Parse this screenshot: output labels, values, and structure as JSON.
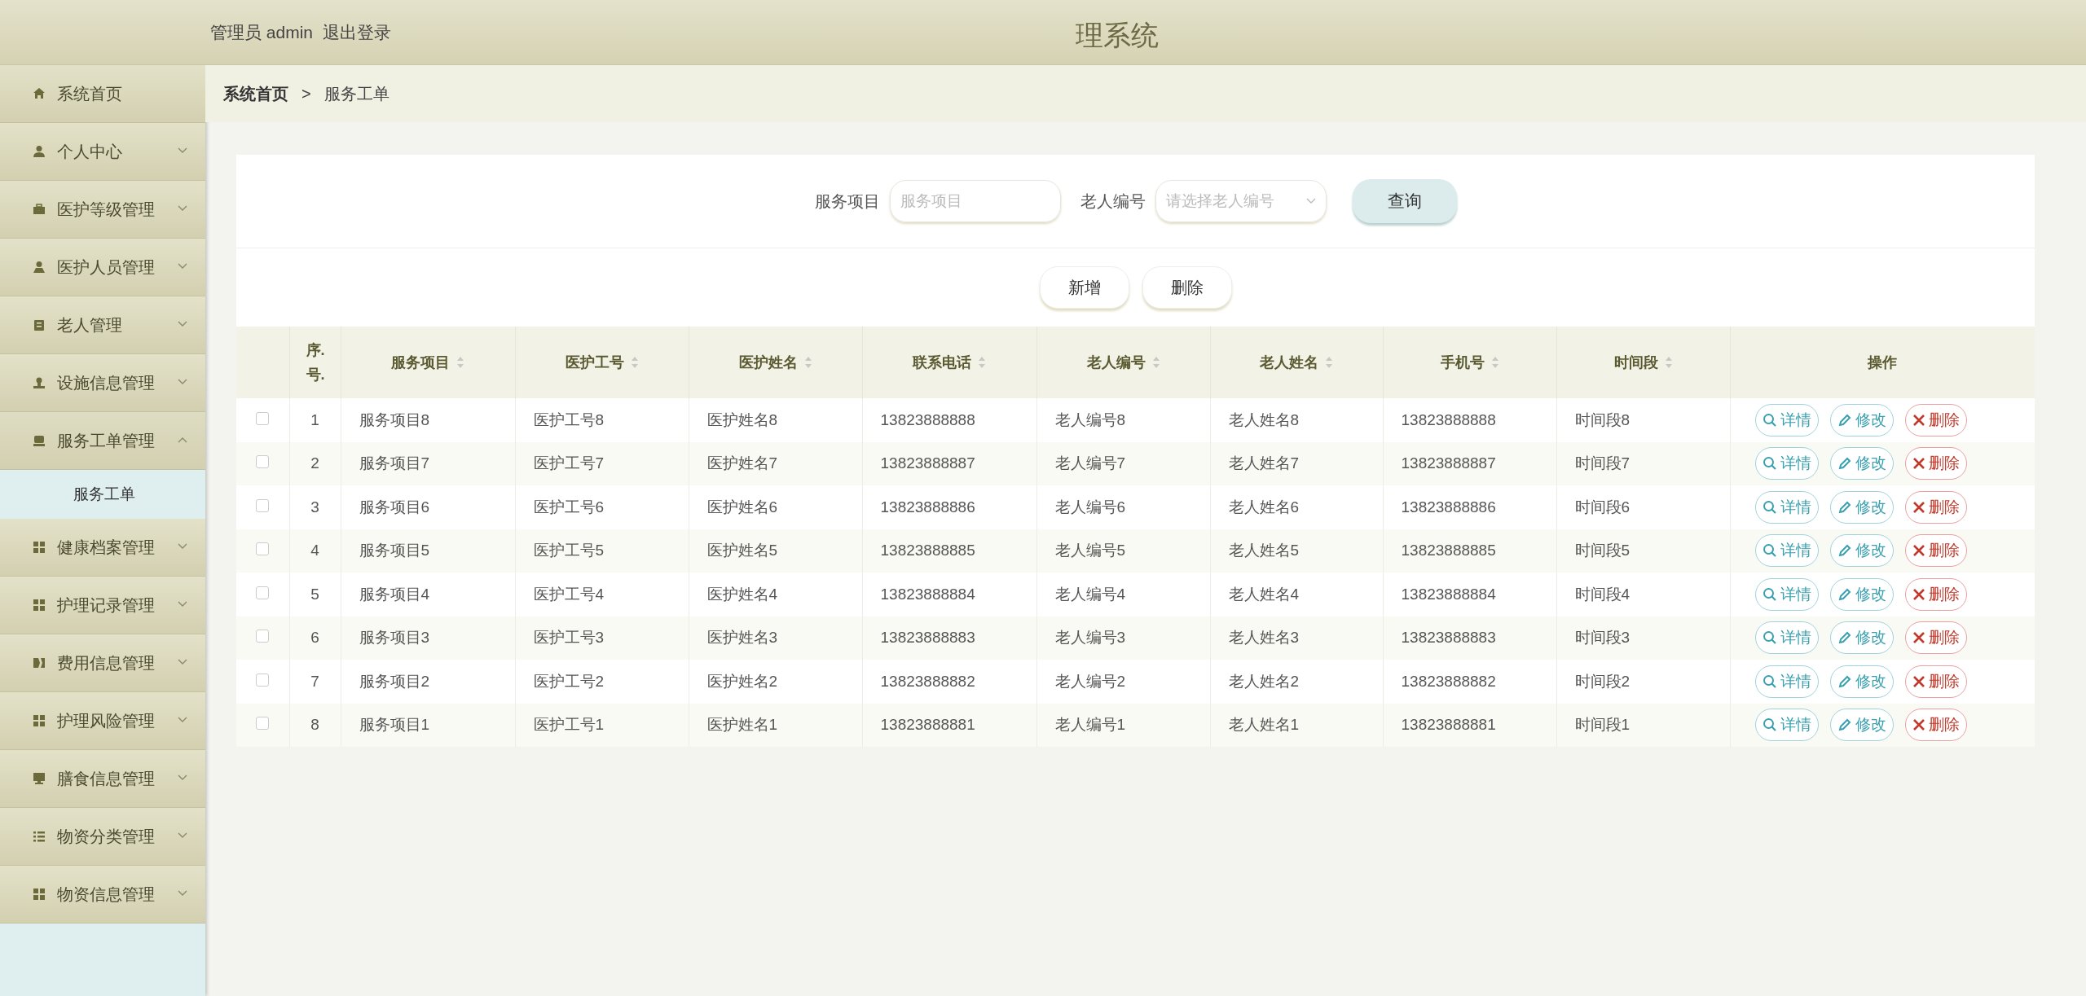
{
  "header": {
    "user_label": "管理员 admin",
    "logout": "退出登录",
    "title": "理系统"
  },
  "sidebar": {
    "items": [
      {
        "label": "系统首页",
        "kind": "link"
      },
      {
        "label": "个人中心",
        "kind": "menu",
        "expanded": false
      },
      {
        "label": "医护等级管理",
        "kind": "menu",
        "expanded": false
      },
      {
        "label": "医护人员管理",
        "kind": "menu",
        "expanded": false
      },
      {
        "label": "老人管理",
        "kind": "menu",
        "expanded": false
      },
      {
        "label": "设施信息管理",
        "kind": "menu",
        "expanded": false
      },
      {
        "label": "服务工单管理",
        "kind": "menu",
        "expanded": true,
        "children": [
          {
            "label": "服务工单",
            "selected": true
          }
        ]
      },
      {
        "label": "健康档案管理",
        "kind": "menu",
        "expanded": false
      },
      {
        "label": "护理记录管理",
        "kind": "menu",
        "expanded": false
      },
      {
        "label": "费用信息管理",
        "kind": "menu",
        "expanded": false
      },
      {
        "label": "护理风险管理",
        "kind": "menu",
        "expanded": false
      },
      {
        "label": "膳食信息管理",
        "kind": "menu",
        "expanded": false
      },
      {
        "label": "物资分类管理",
        "kind": "menu",
        "expanded": false
      },
      {
        "label": "物资信息管理",
        "kind": "menu",
        "expanded": false
      }
    ]
  },
  "breadcrumb": [
    "系统首页",
    ">",
    "服务工单"
  ],
  "search": {
    "fields": [
      {
        "label": "服务项目",
        "placeholder": "服务项目",
        "kind": "input"
      },
      {
        "label": "老人编号",
        "placeholder": "请选择老人编号",
        "kind": "select"
      }
    ],
    "button": "查询"
  },
  "actions": [
    "新增",
    "删除"
  ],
  "table": {
    "columns": [
      {
        "label": "序.号.",
        "sortable": false
      },
      {
        "label": "服务项目",
        "sortable": true
      },
      {
        "label": "医护工号",
        "sortable": true
      },
      {
        "label": "医护姓名",
        "sortable": true
      },
      {
        "label": "联系电话",
        "sortable": true
      },
      {
        "label": "老人编号",
        "sortable": true
      },
      {
        "label": "老人姓名",
        "sortable": true
      },
      {
        "label": "手机号",
        "sortable": true
      },
      {
        "label": "时间段",
        "sortable": true
      },
      {
        "label": "操作",
        "sortable": false
      }
    ],
    "rows": [
      {
        "checked": false,
        "cells": [
          "1",
          "服务项目8",
          "医护工号8",
          "医护姓名8",
          "13823888888",
          "老人编号8",
          "老人姓名8",
          "13823888888",
          "时间段8"
        ],
        "buttons": [
          "详情",
          "修改",
          "删除"
        ]
      },
      {
        "checked": false,
        "cells": [
          "2",
          "服务项目7",
          "医护工号7",
          "医护姓名7",
          "13823888887",
          "老人编号7",
          "老人姓名7",
          "13823888887",
          "时间段7"
        ],
        "buttons": [
          "详情",
          "修改",
          "删除"
        ]
      },
      {
        "checked": false,
        "cells": [
          "3",
          "服务项目6",
          "医护工号6",
          "医护姓名6",
          "13823888886",
          "老人编号6",
          "老人姓名6",
          "13823888886",
          "时间段6"
        ],
        "buttons": [
          "详情",
          "修改",
          "删除"
        ]
      },
      {
        "checked": false,
        "cells": [
          "4",
          "服务项目5",
          "医护工号5",
          "医护姓名5",
          "13823888885",
          "老人编号5",
          "老人姓名5",
          "13823888885",
          "时间段5"
        ],
        "buttons": [
          "详情",
          "修改",
          "删除"
        ]
      },
      {
        "checked": false,
        "cells": [
          "5",
          "服务项目4",
          "医护工号4",
          "医护姓名4",
          "13823888884",
          "老人编号4",
          "老人姓名4",
          "13823888884",
          "时间段4"
        ],
        "buttons": [
          "详情",
          "修改",
          "删除"
        ]
      },
      {
        "checked": false,
        "cells": [
          "6",
          "服务项目3",
          "医护工号3",
          "医护姓名3",
          "13823888883",
          "老人编号3",
          "老人姓名3",
          "13823888883",
          "时间段3"
        ],
        "buttons": [
          "详情",
          "修改",
          "删除"
        ]
      },
      {
        "checked": false,
        "cells": [
          "7",
          "服务项目2",
          "医护工号2",
          "医护姓名2",
          "13823888882",
          "老人编号2",
          "老人姓名2",
          "13823888882",
          "时间段2"
        ],
        "buttons": [
          "详情",
          "修改",
          "删除"
        ]
      },
      {
        "checked": false,
        "cells": [
          "8",
          "服务项目1",
          "医护工号1",
          "医护姓名1",
          "13823888881",
          "老人编号1",
          "老人姓名1",
          "13823888881",
          "时间段1"
        ],
        "buttons": [
          "详情",
          "修改",
          "删除"
        ]
      }
    ]
  }
}
